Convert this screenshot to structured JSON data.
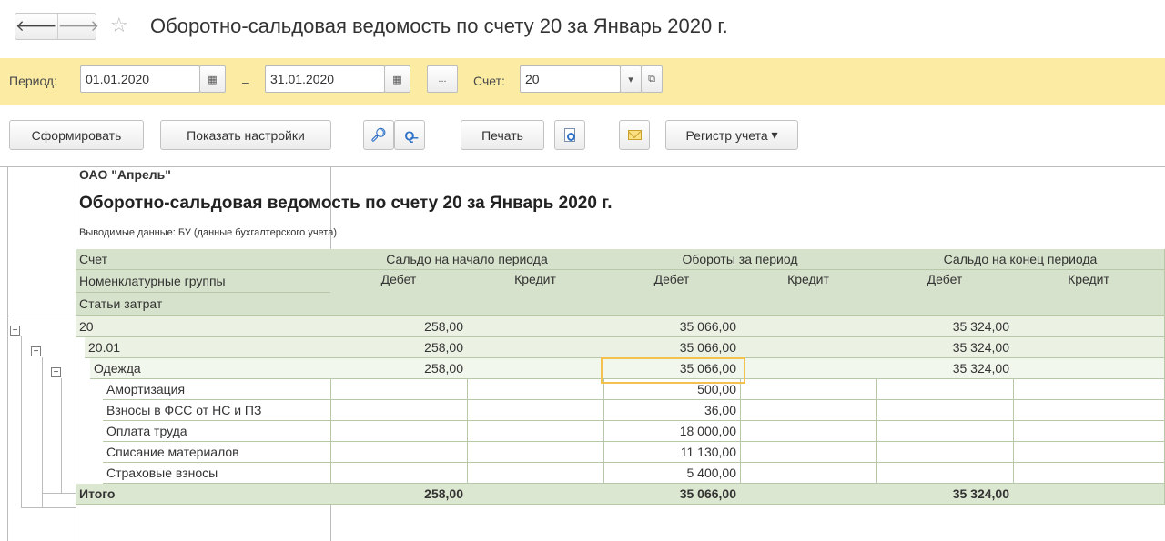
{
  "window": {
    "title": "Оборотно-сальдовая ведомость по счету 20 за Январь 2020 г.",
    "nav_back_icon": "arrow-left-icon",
    "nav_forward_icon": "arrow-right-icon",
    "favorite_icon": "star-icon"
  },
  "params": {
    "period_label": "Период:",
    "date_from": "01.01.2020",
    "date_to": "31.01.2020",
    "dash": "–",
    "select_period_label": "...",
    "account_label": "Счет:",
    "account_value": "20",
    "open_icon": "open-window-icon",
    "dropdown_icon": "chevron-down-icon",
    "calendar_icon": "calendar-icon",
    "panel_color": "#fbeba3"
  },
  "toolbar": {
    "generate_label": "Сформировать",
    "settings_label": "Показать настройки",
    "search_icon": "search-icon",
    "search_next_icon": "search-next-icon",
    "print_label": "Печать",
    "preview_icon": "print-preview-icon",
    "mail_icon": "envelope-icon",
    "register_label": "Регистр учета",
    "register_arrow": "▾"
  },
  "report": {
    "organization": "ОАО \"Апрель\"",
    "title": "Оборотно-сальдовая ведомость по счету 20 за Январь 2020 г.",
    "output_data": "Выводимые данные:  БУ (данные бухгалтерского учета)",
    "header": {
      "account": "Счет",
      "nomenclature_groups": "Номенклатурные группы",
      "cost_items": "Статьи затрат",
      "opening_balance": "Сальдо на начало периода",
      "turnover": "Обороты за период",
      "closing_balance": "Сальдо на конец периода",
      "debit": "Дебет",
      "credit": "Кредит"
    },
    "rows": [
      {
        "name": "20",
        "ob_debit": "258,00",
        "ob_credit": "",
        "t_debit": "35 066,00",
        "t_credit": "",
        "cb_debit": "35 324,00",
        "cb_credit": ""
      },
      {
        "name": "20.01",
        "ob_debit": "258,00",
        "ob_credit": "",
        "t_debit": "35 066,00",
        "t_credit": "",
        "cb_debit": "35 324,00",
        "cb_credit": ""
      },
      {
        "name": "Одежда",
        "ob_debit": "258,00",
        "ob_credit": "",
        "t_debit": "35 066,00",
        "t_credit": "",
        "cb_debit": "35 324,00",
        "cb_credit": ""
      },
      {
        "name": "Амортизация",
        "ob_debit": "",
        "ob_credit": "",
        "t_debit": "500,00",
        "t_credit": "",
        "cb_debit": "",
        "cb_credit": ""
      },
      {
        "name": "Взносы в ФСС от НС и ПЗ",
        "ob_debit": "",
        "ob_credit": "",
        "t_debit": "36,00",
        "t_credit": "",
        "cb_debit": "",
        "cb_credit": ""
      },
      {
        "name": "Оплата труда",
        "ob_debit": "",
        "ob_credit": "",
        "t_debit": "18 000,00",
        "t_credit": "",
        "cb_debit": "",
        "cb_credit": ""
      },
      {
        "name": "Списание материалов",
        "ob_debit": "",
        "ob_credit": "",
        "t_debit": "11 130,00",
        "t_credit": "",
        "cb_debit": "",
        "cb_credit": ""
      },
      {
        "name": "Страховые взносы",
        "ob_debit": "",
        "ob_credit": "",
        "t_debit": "5 400,00",
        "t_credit": "",
        "cb_debit": "",
        "cb_credit": ""
      }
    ],
    "total": {
      "name": "Итого",
      "ob_debit": "258,00",
      "ob_credit": "",
      "t_debit": "35 066,00",
      "t_credit": "",
      "cb_debit": "35 324,00",
      "cb_credit": ""
    },
    "collapse_symbol": "−",
    "selected_cell": "Одежда / Обороты за период / Дебет"
  }
}
